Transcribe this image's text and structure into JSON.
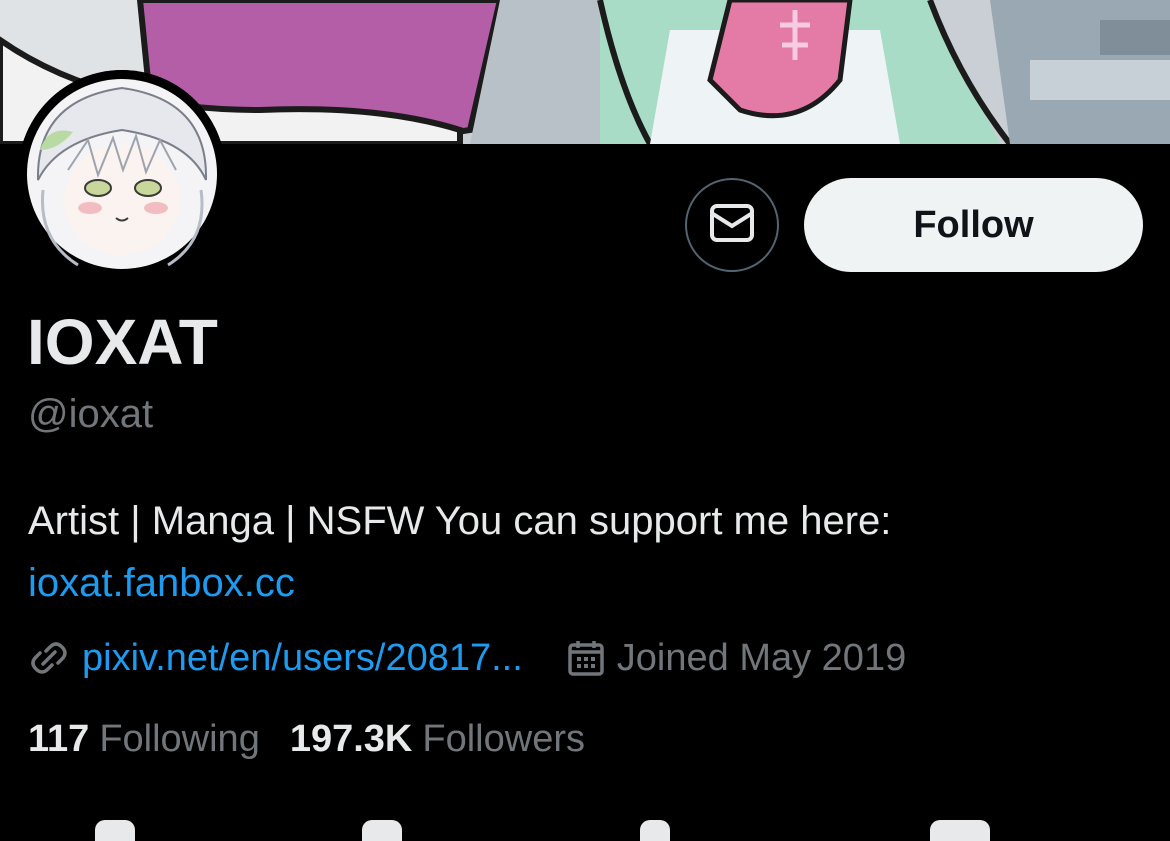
{
  "profile": {
    "display_name": "IOXAT",
    "handle": "@ioxat",
    "bio_text": "Artist | Manga | NSFW You can support me here:",
    "bio_link": "ioxat.fanbox.cc",
    "website": "pixiv.net/en/users/20817...",
    "joined": "Joined May 2019"
  },
  "actions": {
    "message_icon": "envelope-icon",
    "follow_label": "Follow"
  },
  "stats": {
    "following_count": "117",
    "following_label": "Following",
    "followers_count": "197.3K",
    "followers_label": "Followers"
  },
  "icons": {
    "website": "link-icon",
    "joined": "calendar-icon"
  },
  "colors": {
    "background": "#000000",
    "link": "#1d9bf0",
    "secondary_text": "#71767b",
    "primary_text": "#e7e9ea",
    "follow_button_bg": "#eff3f4"
  }
}
